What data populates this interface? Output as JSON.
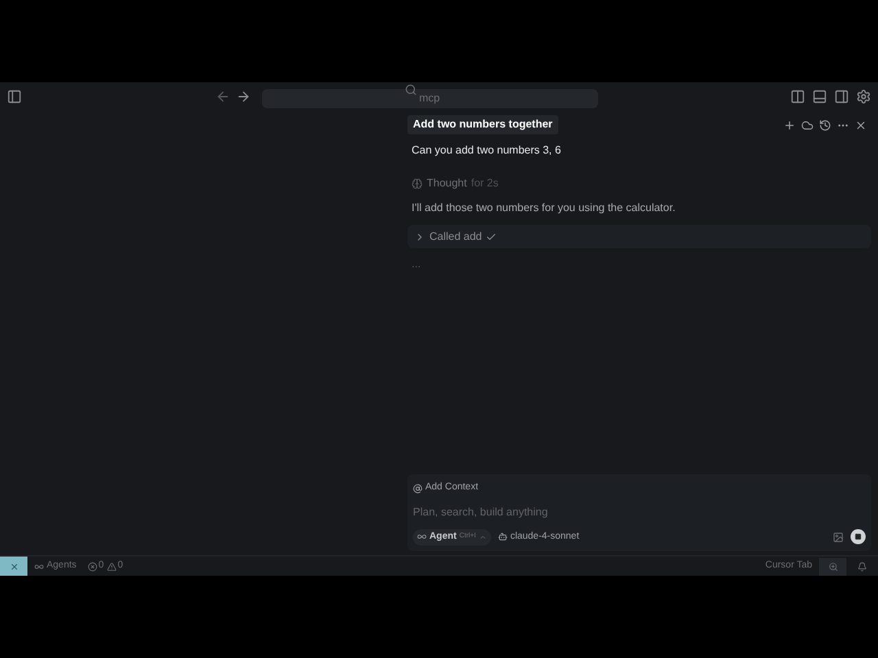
{
  "search": {
    "placeholder": "mcp"
  },
  "chat": {
    "title": "Add two numbers together",
    "user_message": "Can you add two numbers 3, 6",
    "thought": {
      "label": "Thought",
      "duration": "for 2s"
    },
    "reply": "I'll add those two numbers for you using the calculator.",
    "tool_call": {
      "label": "Called add",
      "expanded": false,
      "done": true
    },
    "pending": "...",
    "composer": {
      "context": "Add Context",
      "placeholder": "Plan, search, build anything",
      "mode": "Agent",
      "shortcut": "Ctrl+I",
      "model": "claude-4-sonnet"
    }
  },
  "status_bar": {
    "agents": "Agents",
    "errors": "0",
    "warnings": "0",
    "tab": "Cursor Tab"
  }
}
